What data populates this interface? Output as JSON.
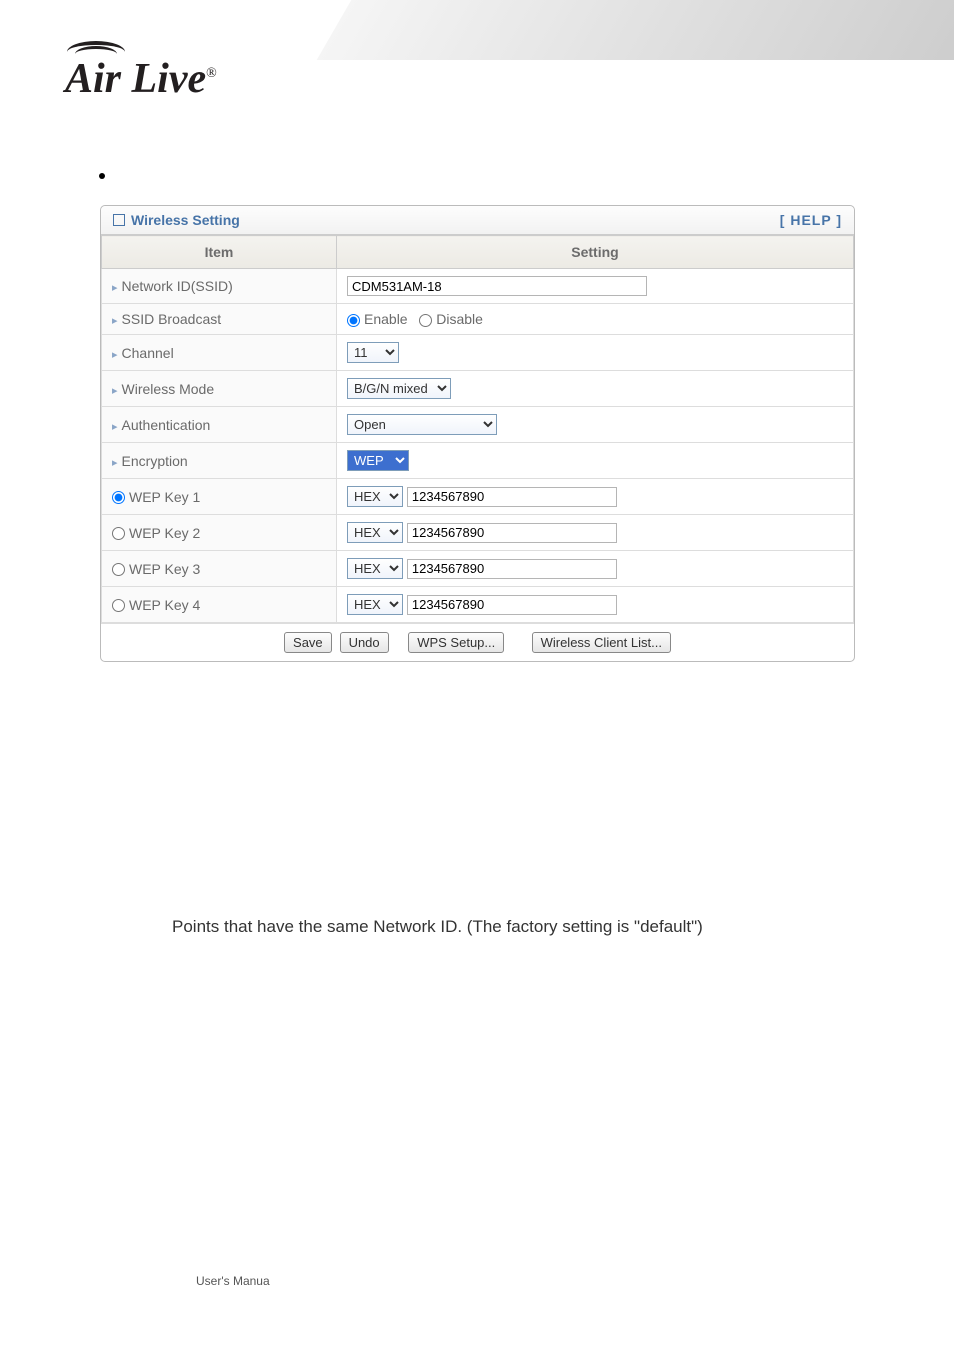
{
  "logo_text": "Air Live",
  "panel": {
    "title": "Wireless Setting",
    "help": "[ HELP ]",
    "col_item": "Item",
    "col_setting": "Setting",
    "rows": {
      "ssid_label": "Network ID(SSID)",
      "ssid_value": "CDM531AM-18",
      "broadcast_label": "SSID Broadcast",
      "broadcast_enable": "Enable",
      "broadcast_disable": "Disable",
      "channel_label": "Channel",
      "channel_value": "11",
      "mode_label": "Wireless Mode",
      "mode_value": "B/G/N mixed",
      "auth_label": "Authentication",
      "auth_value": "Open",
      "enc_label": "Encryption",
      "enc_value": "WEP",
      "wep1_label": "WEP Key 1",
      "wep2_label": "WEP Key 2",
      "wep3_label": "WEP Key 3",
      "wep4_label": "WEP Key 4",
      "wep_format": "HEX",
      "wep_value": "1234567890"
    },
    "buttons": {
      "save": "Save",
      "undo": "Undo",
      "wps": "WPS Setup...",
      "clients": "Wireless Client List..."
    }
  },
  "body_line": "Points that have the same Network ID. (The factory setting is \"default\")",
  "footer": "User's Manua"
}
